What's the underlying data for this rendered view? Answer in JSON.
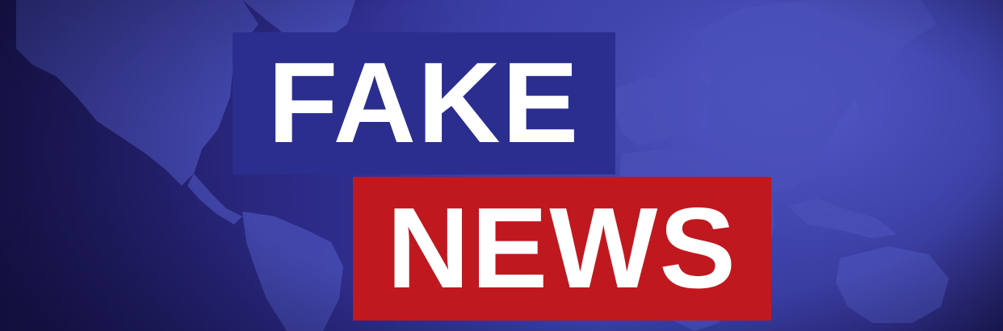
{
  "banner": {
    "line1": "FAKE",
    "line2": "NEWS"
  },
  "colors": {
    "fake_box": "#2b2e8e",
    "news_box": "#c0181f",
    "text": "#ffffff",
    "background": "#2c2a86"
  },
  "background_graphic": "world-map"
}
